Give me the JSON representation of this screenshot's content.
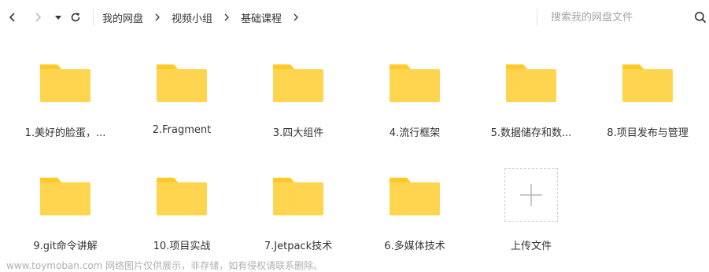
{
  "breadcrumb": [
    "我的网盘",
    "视频小组",
    "基础课程"
  ],
  "search": {
    "placeholder": "搜索我的网盘文件"
  },
  "icons": {
    "back": "chevron-left-icon",
    "forward": "chevron-right-icon",
    "dropdown": "caret-down-icon",
    "refresh": "refresh-icon",
    "search": "search-icon",
    "folder": "folder-icon",
    "upload": "plus-icon"
  },
  "colors": {
    "folder": "#FFD54F",
    "folder_tab": "#FFCA28"
  },
  "folders": [
    "1.美好的脸蛋，...",
    "2.Fragment",
    "3.四大组件",
    "4.流行框架",
    "5.数据储存和数...",
    "8.项目发布与管理",
    "9.git命令讲解",
    "10.项目实战",
    "7.Jetpack技术",
    "6.多媒体技术"
  ],
  "upload": {
    "label": "上传文件"
  },
  "watermark": "www.toymoban.com 网络图片仅供展示，非存储，如有侵权请联系删除。"
}
